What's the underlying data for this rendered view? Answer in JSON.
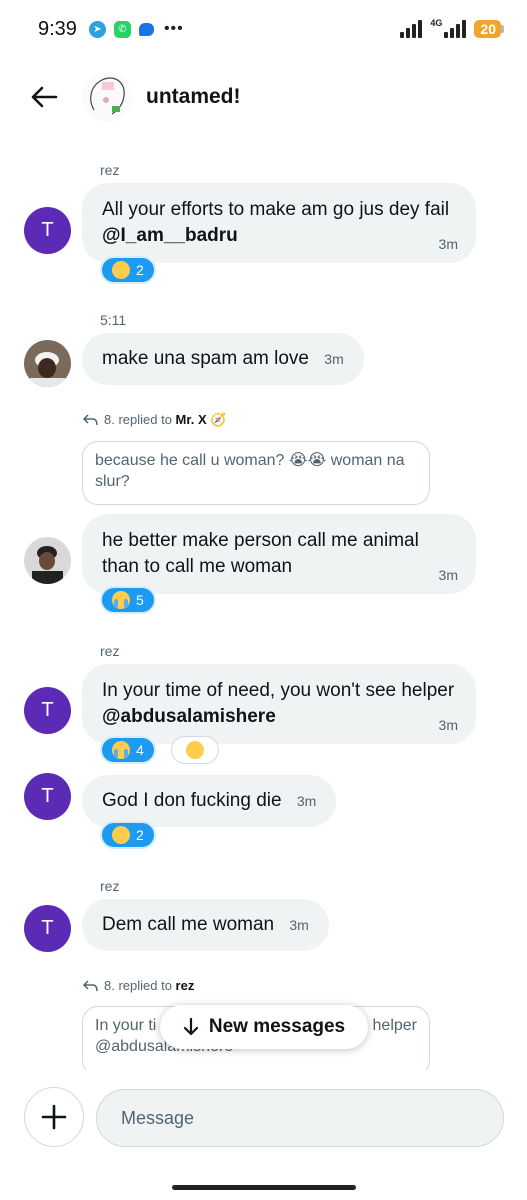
{
  "status_bar": {
    "time": "9:39",
    "network": "4G",
    "battery": "20"
  },
  "header": {
    "title": "untamed!",
    "back_icon": "arrow-left-icon"
  },
  "messages": [
    {
      "sender": "rez",
      "text": "All your efforts to make am go jus dey fail ",
      "mention": "@I_am__badru",
      "time": "3m",
      "reactions": [
        {
          "emoji": "😂",
          "count": "2"
        }
      ]
    },
    {
      "sender": "5:11",
      "text": "make una spam am love",
      "time": "3m"
    },
    {
      "reply_prefix": "8. replied to ",
      "reply_to": "Mr. X 🧭",
      "quote": "because he call u woman? 😭😭 woman na slur?",
      "text": "he better make person call me animal than to call me woman",
      "time": "3m",
      "reactions": [
        {
          "emoji": "😭",
          "count": "5"
        }
      ]
    },
    {
      "sender": "rez",
      "text": "In your time of need, you won't see helper ",
      "mention": "@abdusalamishere",
      "time": "3m",
      "reactions": [
        {
          "emoji": "😭",
          "count": "4"
        },
        {
          "emoji": "😂",
          "count": ""
        }
      ]
    },
    {
      "text": "God I don fucking die",
      "time": "3m",
      "reactions": [
        {
          "emoji": "😂",
          "count": "2"
        }
      ]
    },
    {
      "sender": "rez",
      "text": "Dem call me woman",
      "time": "3m"
    },
    {
      "reply_prefix": "8. replied to ",
      "reply_to": "rez",
      "quote_start": "In your ti",
      "quote_end": "helper",
      "quote_mention": "@abdusalamishere"
    }
  ],
  "avatar_initial": "T",
  "new_messages_label": "New messages",
  "composer": {
    "placeholder": "Message"
  }
}
